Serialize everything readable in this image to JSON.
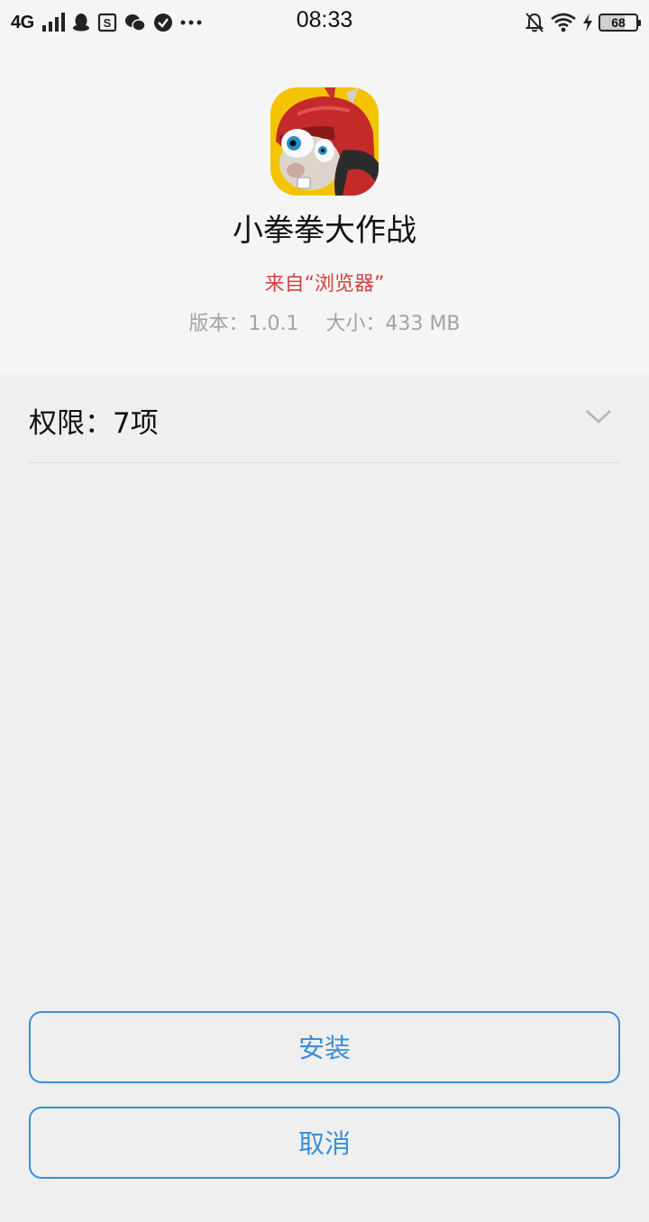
{
  "status_bar": {
    "network": "4G",
    "time": "08:33",
    "battery": "68",
    "icons_left": [
      "signal-icon",
      "qq-icon",
      "s-app-icon",
      "wechat-icon",
      "check-circle-icon",
      "more-dots-icon"
    ],
    "icons_right": [
      "notification-off-icon",
      "wifi-icon",
      "charging-icon",
      "battery-icon"
    ]
  },
  "app": {
    "name": "小拳拳大作战",
    "source": "来自“浏览器”",
    "version_label": "版本：1.0.1",
    "size_label": "大小：433 MB",
    "icon_bg_color": "#f5c400"
  },
  "permissions": {
    "label": "权限：7项",
    "expand_icon": "chevron-down-icon"
  },
  "buttons": {
    "install": "安装",
    "cancel": "取消",
    "accent_color": "#3b8fd9"
  }
}
